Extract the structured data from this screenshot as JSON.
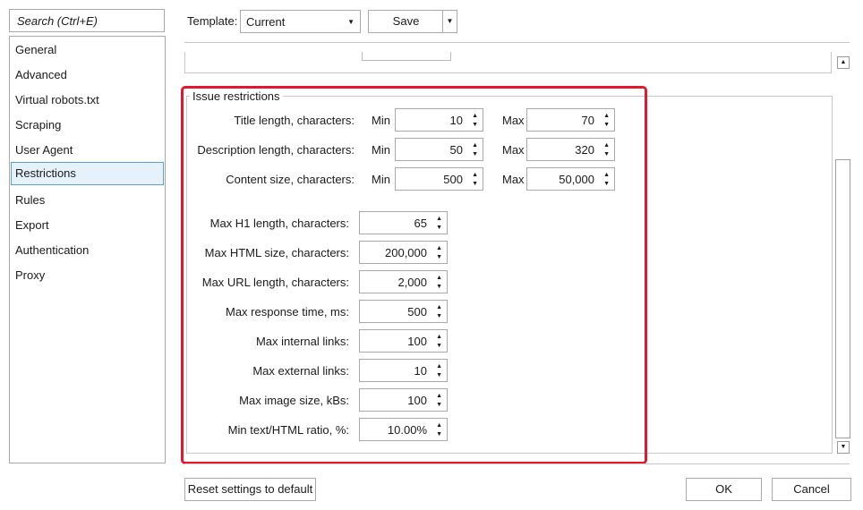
{
  "search": {
    "placeholder": "Search (Ctrl+E)"
  },
  "sidebar": {
    "items": [
      {
        "label": "General"
      },
      {
        "label": "Advanced"
      },
      {
        "label": "Virtual robots.txt"
      },
      {
        "label": "Scraping"
      },
      {
        "label": "User Agent"
      },
      {
        "label": "Restrictions",
        "selected": true
      },
      {
        "label": "Rules"
      },
      {
        "label": "Export"
      },
      {
        "label": "Authentication"
      },
      {
        "label": "Proxy"
      }
    ]
  },
  "toolbar": {
    "template_label": "Template:",
    "template_value": "Current",
    "save_label": "Save"
  },
  "group": {
    "title": "Issue restrictions",
    "min_label": "Min",
    "max_label": "Max",
    "range_rows": [
      {
        "label": "Title length, characters:",
        "min": "10",
        "max": "70"
      },
      {
        "label": "Description length, characters:",
        "min": "50",
        "max": "320"
      },
      {
        "label": "Content size, characters:",
        "min": "500",
        "max": "50,000"
      }
    ],
    "single_rows": [
      {
        "label": "Max H1 length, characters:",
        "value": "65"
      },
      {
        "label": "Max HTML size, characters:",
        "value": "200,000"
      },
      {
        "label": "Max URL length, characters:",
        "value": "2,000"
      },
      {
        "label": "Max response time, ms:",
        "value": "500"
      },
      {
        "label": "Max internal links:",
        "value": "100"
      },
      {
        "label": "Max external links:",
        "value": "10"
      },
      {
        "label": "Max image size, kBs:",
        "value": "100"
      },
      {
        "label": "Min text/HTML ratio, %:",
        "value": "10.00%"
      }
    ]
  },
  "footer": {
    "reset_label": "Reset settings to default",
    "ok_label": "OK",
    "cancel_label": "Cancel"
  },
  "colors": {
    "highlight": "#e3172d",
    "selection": "#e5f1fb",
    "selection_border": "#5a9fd9"
  },
  "icons": [
    "chevron-down-icon",
    "spin-up-icon",
    "spin-down-icon",
    "scroll-up-icon",
    "scroll-down-icon"
  ]
}
